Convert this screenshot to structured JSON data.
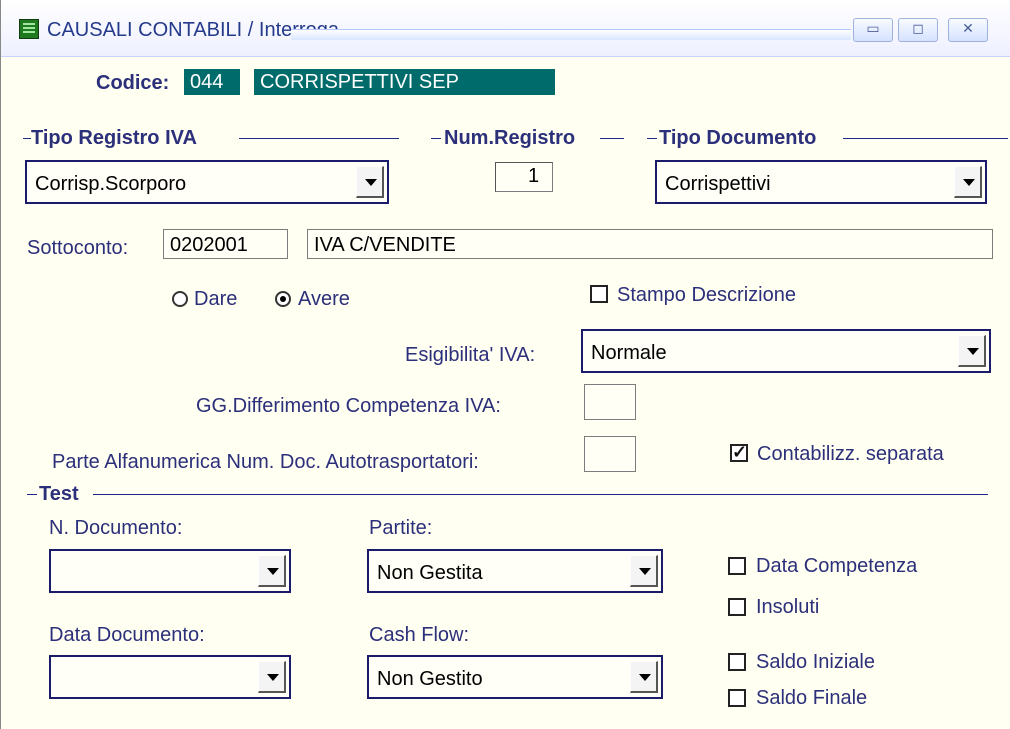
{
  "window": {
    "title": "CAUSALI CONTABILI / Interroga",
    "icons": [
      "minimize-icon",
      "restore-icon",
      "close-icon"
    ]
  },
  "header": {
    "codice_label": "Codice:",
    "codice_value": "044",
    "descrizione_value": "CORRISPETTIVI SEP"
  },
  "sections": {
    "tipo_registro": "Tipo Registro IVA",
    "num_registro": "Num.Registro",
    "tipo_documento": "Tipo Documento",
    "test": "Test"
  },
  "fields": {
    "tipo_registro_value": "Corrisp.Scorporo",
    "num_registro_value": "1",
    "tipo_documento_value": "Corrispettivi",
    "sottoconto_label": "Sottoconto:",
    "sottoconto_code": "0202001",
    "sottoconto_desc": "IVA C/VENDITE",
    "dare_label": "Dare",
    "avere_label": "Avere",
    "stampo_descrizione_label": "Stampo Descrizione",
    "esigibilita_label": "Esigibilita' IVA:",
    "esigibilita_value": "Normale",
    "gg_diff_label": "GG.Differimento Competenza IVA:",
    "gg_diff_value": "",
    "parte_alfa_label": "Parte Alfanumerica Num. Doc. Autotrasportatori:",
    "parte_alfa_value": "",
    "contabilizz_label": "Contabilizz. separata",
    "n_documento_label": "N. Documento:",
    "n_documento_value": "",
    "partite_label": "Partite:",
    "partite_value": "Non Gestita",
    "data_documento_label": "Data Documento:",
    "data_documento_value": "",
    "cash_flow_label": "Cash Flow:",
    "cash_flow_value": "Non Gestito",
    "data_competenza_label": "Data Competenza",
    "insoluti_label": "Insoluti",
    "saldo_iniziale_label": "Saldo Iniziale",
    "saldo_finale_label": "Saldo Finale"
  },
  "state": {
    "radio_selected": "Avere",
    "stampo_descrizione_checked": false,
    "contabilizz_checked": true,
    "data_competenza_checked": false,
    "insoluti_checked": false,
    "saldo_iniziale_checked": false,
    "saldo_finale_checked": false
  },
  "colors": {
    "label": "#2c2f7a",
    "accent_teal": "#006b6b",
    "form_bg": "#fffff2"
  }
}
